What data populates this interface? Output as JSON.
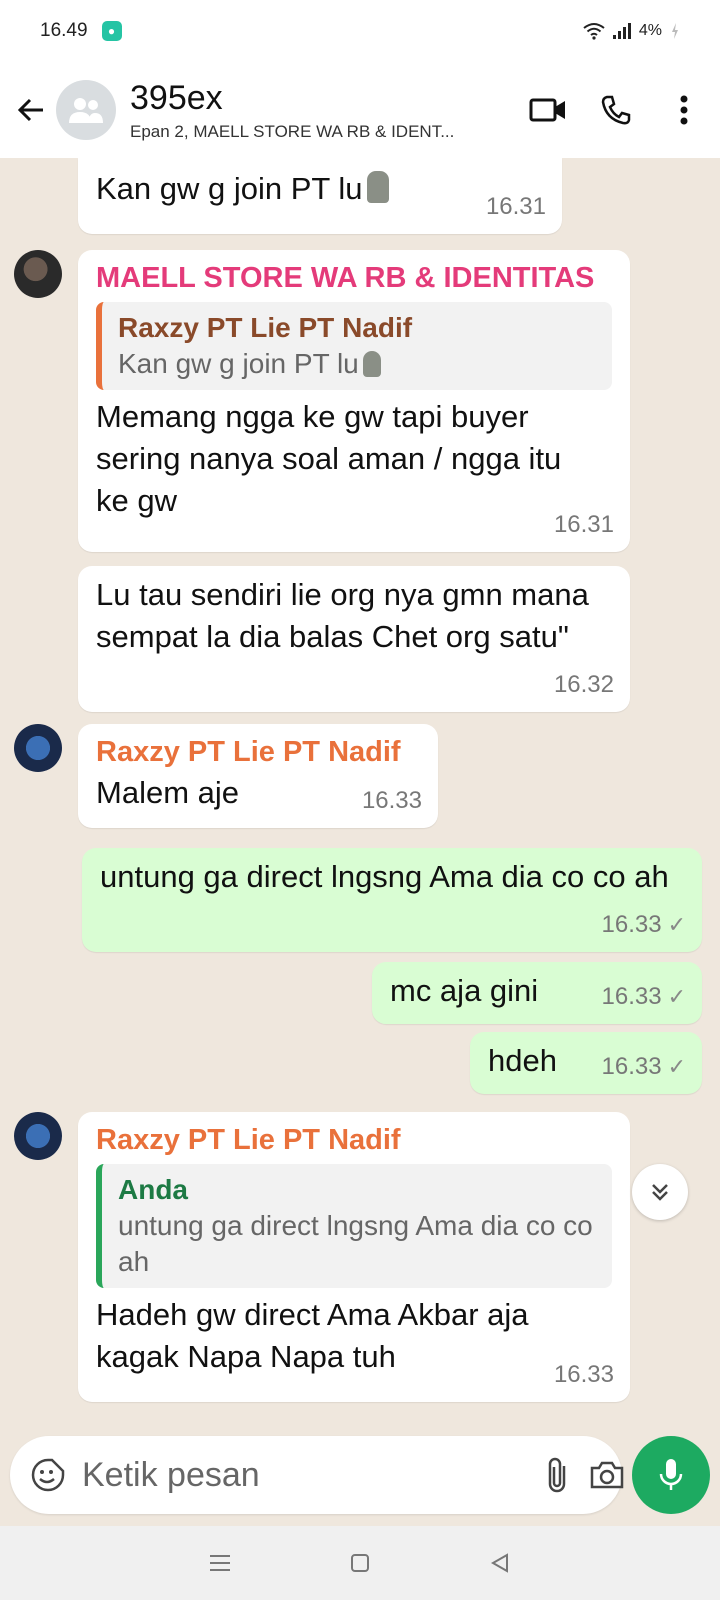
{
  "status_bar": {
    "time": "16.49",
    "battery": "4%"
  },
  "header": {
    "title": "395ex",
    "subtitle": "Epan 2, MAELL STORE WA RB & IDENT..."
  },
  "messages": [
    {
      "text": "Kan gw g join PT lu",
      "time": "16.31"
    },
    {
      "sender": "MAELL STORE WA RB & IDENTITAS",
      "quote_name": "Raxzy PT Lie PT Nadif",
      "quote_text": "Kan gw g join PT lu",
      "text": "Memang ngga ke gw tapi buyer sering nanya soal aman / ngga itu ke gw",
      "time": "16.31"
    },
    {
      "text": "Lu tau sendiri lie org nya gmn mana sempat la dia balas Chet org satu\"",
      "time": "16.32"
    },
    {
      "sender": "Raxzy PT Lie PT Nadif",
      "text": "Malem aje",
      "time": "16.33"
    },
    {
      "text": "untung ga direct lngsng Ama dia co co ah",
      "time": "16.33"
    },
    {
      "text": "mc aja gini",
      "time": "16.33"
    },
    {
      "text": "hdeh",
      "time": "16.33"
    },
    {
      "sender": "Raxzy PT Lie PT Nadif",
      "quote_name": "Anda",
      "quote_text": "untung ga direct lngsng Ama dia co co ah",
      "text": "Hadeh gw direct Ama Akbar aja kagak Napa Napa tuh",
      "time": "16.33"
    }
  ],
  "input": {
    "placeholder": "Ketik pesan"
  },
  "colors": {
    "accent": "#1daa61",
    "outgoing": "#d9fdd3",
    "sender_pink": "#e43b7a",
    "sender_orange": "#e9713b"
  }
}
